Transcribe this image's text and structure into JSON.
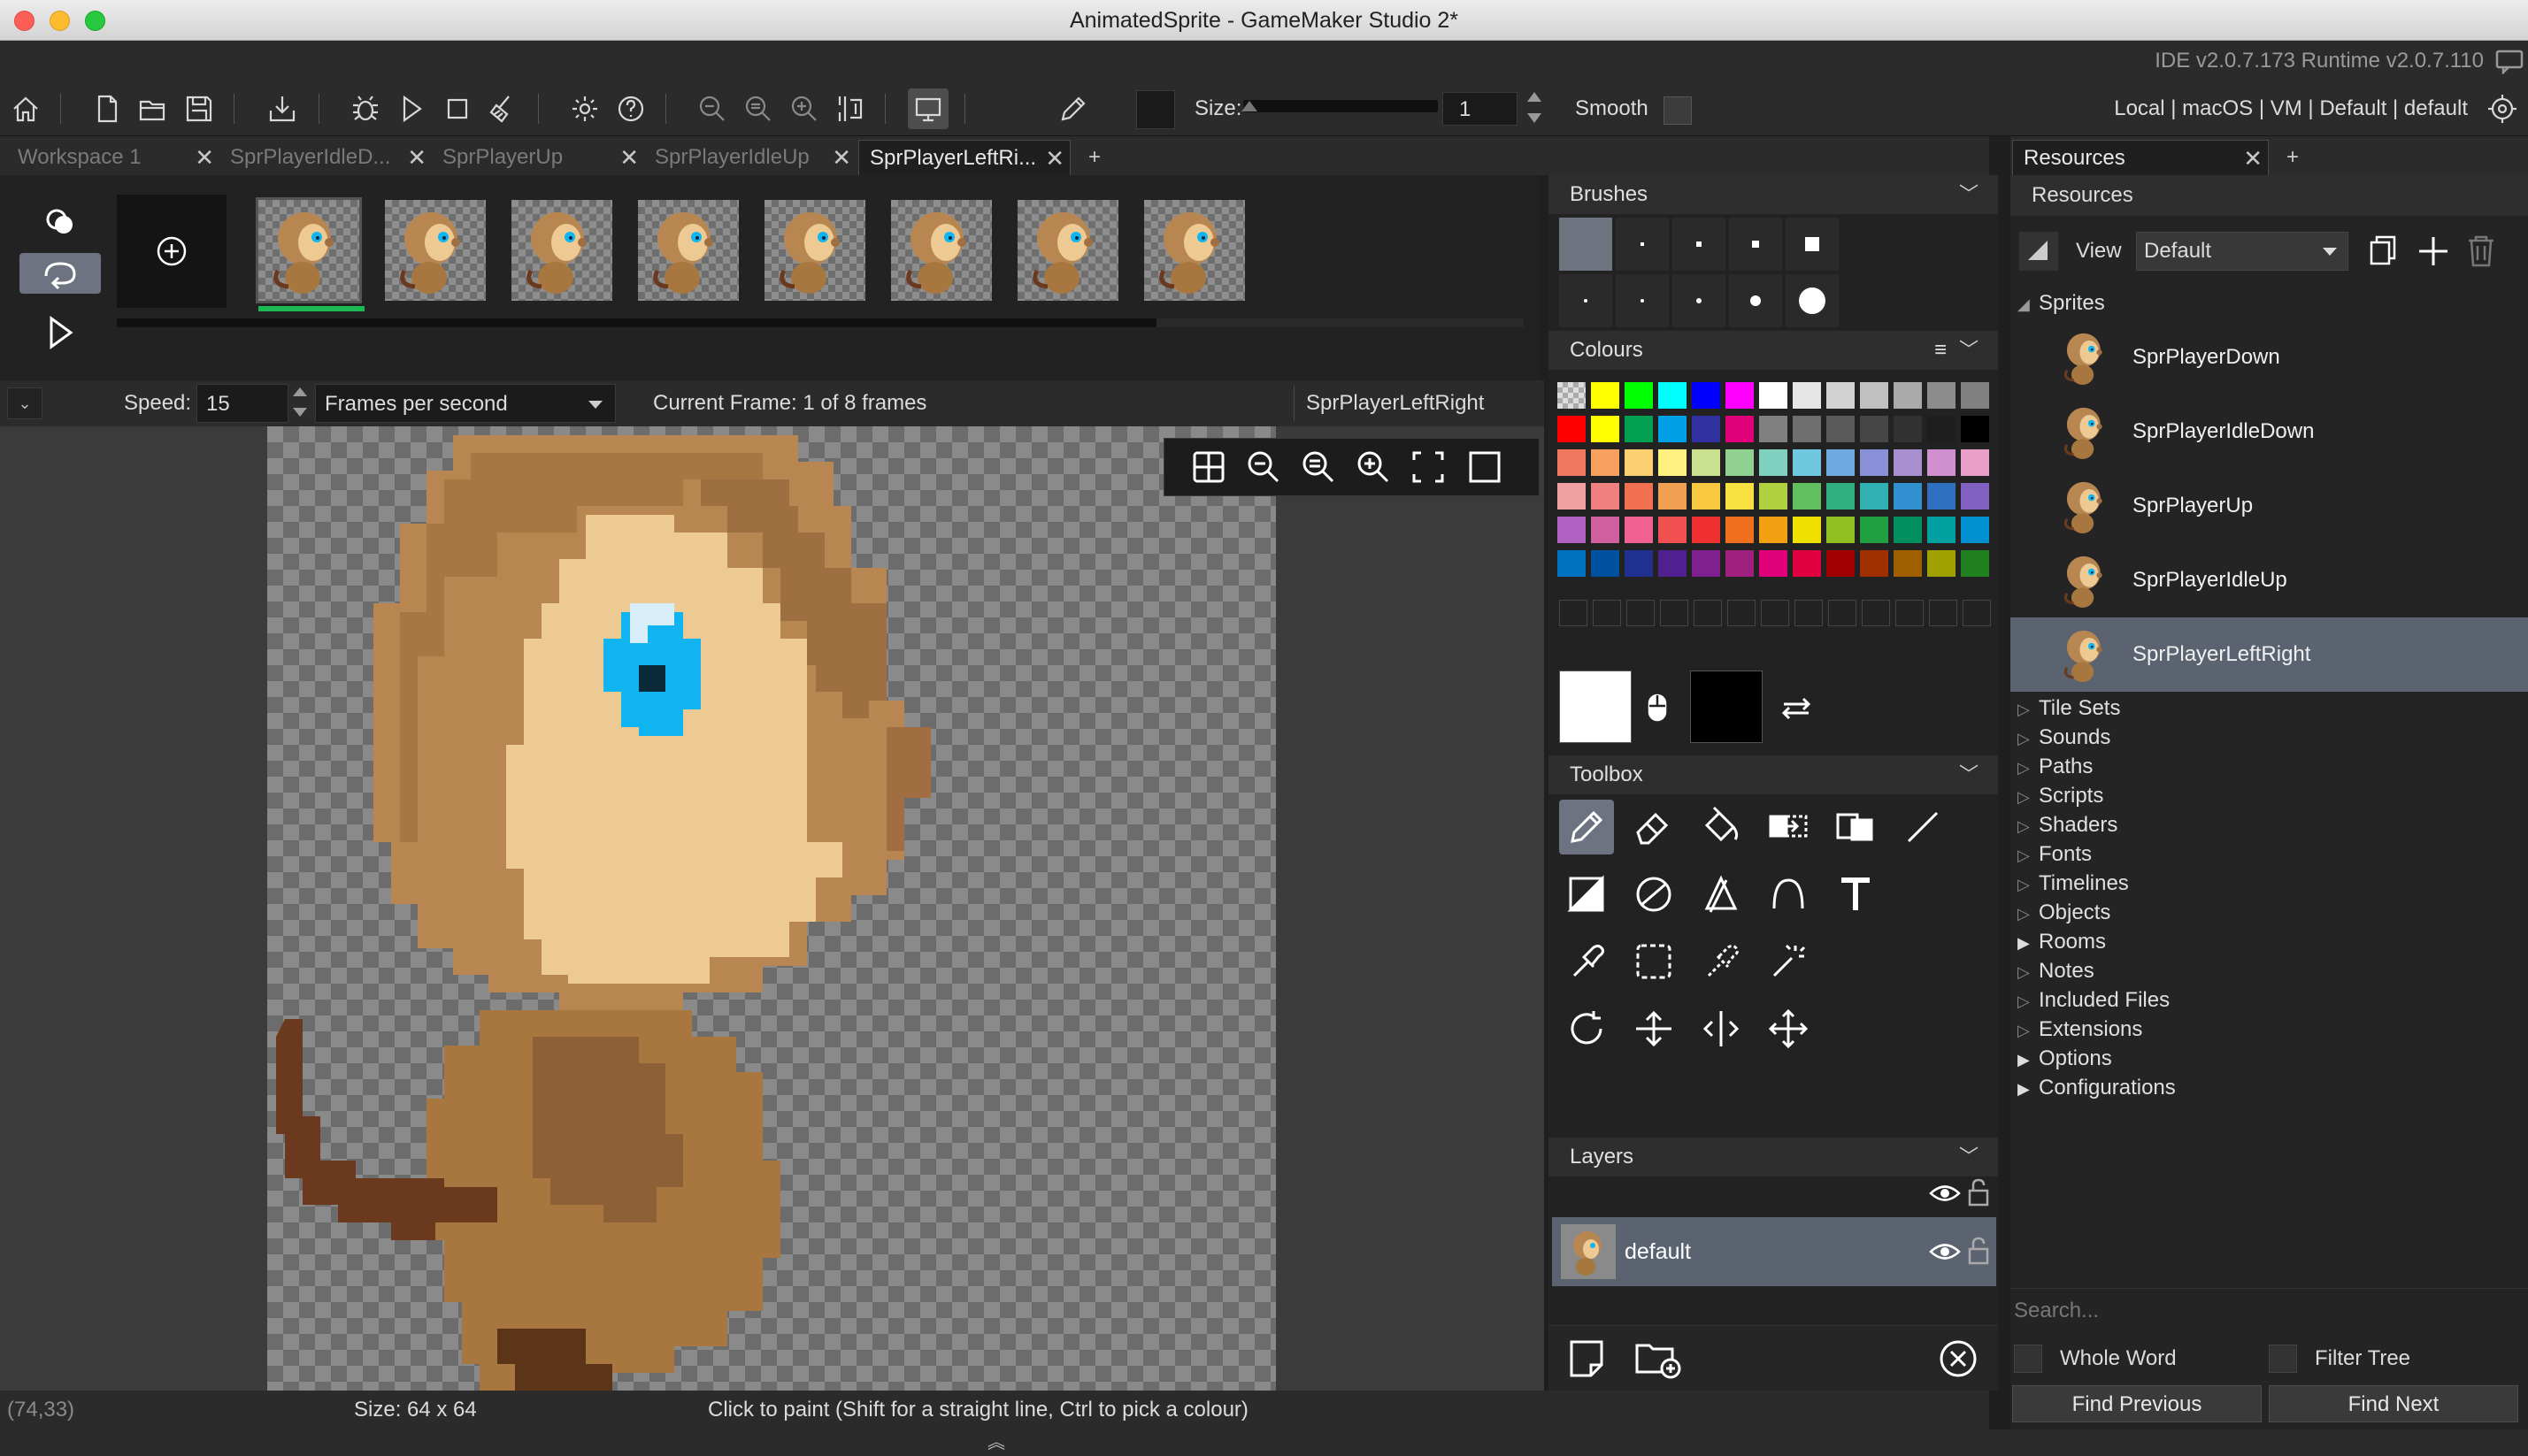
{
  "window": {
    "title": "AnimatedSprite - GameMaker Studio 2*"
  },
  "ide_info": "IDE v2.0.7.173 Runtime v2.0.7.110",
  "toolbar": {
    "size_label": "Size:",
    "size_value": "1",
    "smooth_label": "Smooth",
    "target_info": "Local | macOS | VM | Default | default"
  },
  "tabs": [
    {
      "label": "Workspace 1"
    },
    {
      "label": "SprPlayerIdleD..."
    },
    {
      "label": "SprPlayerUp"
    },
    {
      "label": "SprPlayerIdleUp"
    },
    {
      "label": "SprPlayerLeftRi..."
    }
  ],
  "tab_add": "+",
  "resources_tab": {
    "label": "Resources",
    "add": "+"
  },
  "speedbar": {
    "speed_label": "Speed:",
    "speed_value": "15",
    "unit": "Frames per second",
    "current_frame": "Current Frame: 1 of 8 frames",
    "sprite_name": "SprPlayerLeftRight"
  },
  "panels": {
    "brushes": "Brushes",
    "colours": "Colours",
    "toolbox": "Toolbox",
    "layers": "Layers"
  },
  "colours": {
    "rows": [
      [
        "#00000000",
        "#ffff00",
        "#00ff00",
        "#00ffff",
        "#0000ff",
        "#ff00ff",
        "#ffffff",
        "#e6e6e6",
        "#d2d2d2",
        "#c0c0c0",
        "#aaaaaa",
        "#8c8c8c",
        "#808080"
      ],
      [
        "#ff0000",
        "#ffff00",
        "#00a050",
        "#00a0e6",
        "#3030a0",
        "#e0007a",
        "#808080",
        "#6e6e6e",
        "#5a5a5a",
        "#464646",
        "#323232",
        "#1e1e1e",
        "#000000"
      ],
      [
        "#f07860",
        "#f8a060",
        "#fcd070",
        "#fff080",
        "#c8e090",
        "#90d090",
        "#80d0c0",
        "#70c8e0",
        "#70a8e0",
        "#8890d8",
        "#a890d0",
        "#d090d0",
        "#e8a0c8"
      ],
      [
        "#f0a0a0",
        "#f08080",
        "#f07050",
        "#f0a050",
        "#f8c840",
        "#f8e040",
        "#b0d040",
        "#60c060",
        "#30b080",
        "#30b0b0",
        "#3090d0",
        "#3070c0",
        "#8060c0"
      ],
      [
        "#b060c0",
        "#d060a0",
        "#f06090",
        "#f05050",
        "#f03030",
        "#f07020",
        "#f0a010",
        "#f0e000",
        "#90c020",
        "#20a040",
        "#009060",
        "#00a0a0",
        "#0090d0"
      ],
      [
        "#0070c0",
        "#0050a0",
        "#203090",
        "#502090",
        "#802090",
        "#a02080",
        "#e0007a",
        "#e00040",
        "#a00000",
        "#a03000",
        "#a06000",
        "#a0a000",
        "#208020"
      ]
    ],
    "primary": "#ffffff",
    "secondary": "#000000"
  },
  "layers": [
    {
      "name": "default"
    }
  ],
  "resources": {
    "header": "Resources",
    "view_label": "View",
    "view_value": "Default",
    "sprites_label": "Sprites",
    "sprites": [
      {
        "name": "SprPlayerDown"
      },
      {
        "name": "SprPlayerIdleDown"
      },
      {
        "name": "SprPlayerUp"
      },
      {
        "name": "SprPlayerIdleUp"
      },
      {
        "name": "SprPlayerLeftRight"
      }
    ],
    "groups": [
      "Tile Sets",
      "Sounds",
      "Paths",
      "Scripts",
      "Shaders",
      "Fonts",
      "Timelines",
      "Objects",
      "Rooms",
      "Notes",
      "Included Files",
      "Extensions",
      "Options",
      "Configurations"
    ],
    "search_placeholder": "Search...",
    "whole_word": "Whole Word",
    "filter_tree": "Filter Tree",
    "find_previous": "Find Previous",
    "find_next": "Find Next"
  },
  "status": {
    "coords": "(74,33)",
    "size": "Size: 64 x 64",
    "hint": "Click to paint (Shift for a straight line, Ctrl to pick a colour)"
  },
  "frames_count": 8
}
